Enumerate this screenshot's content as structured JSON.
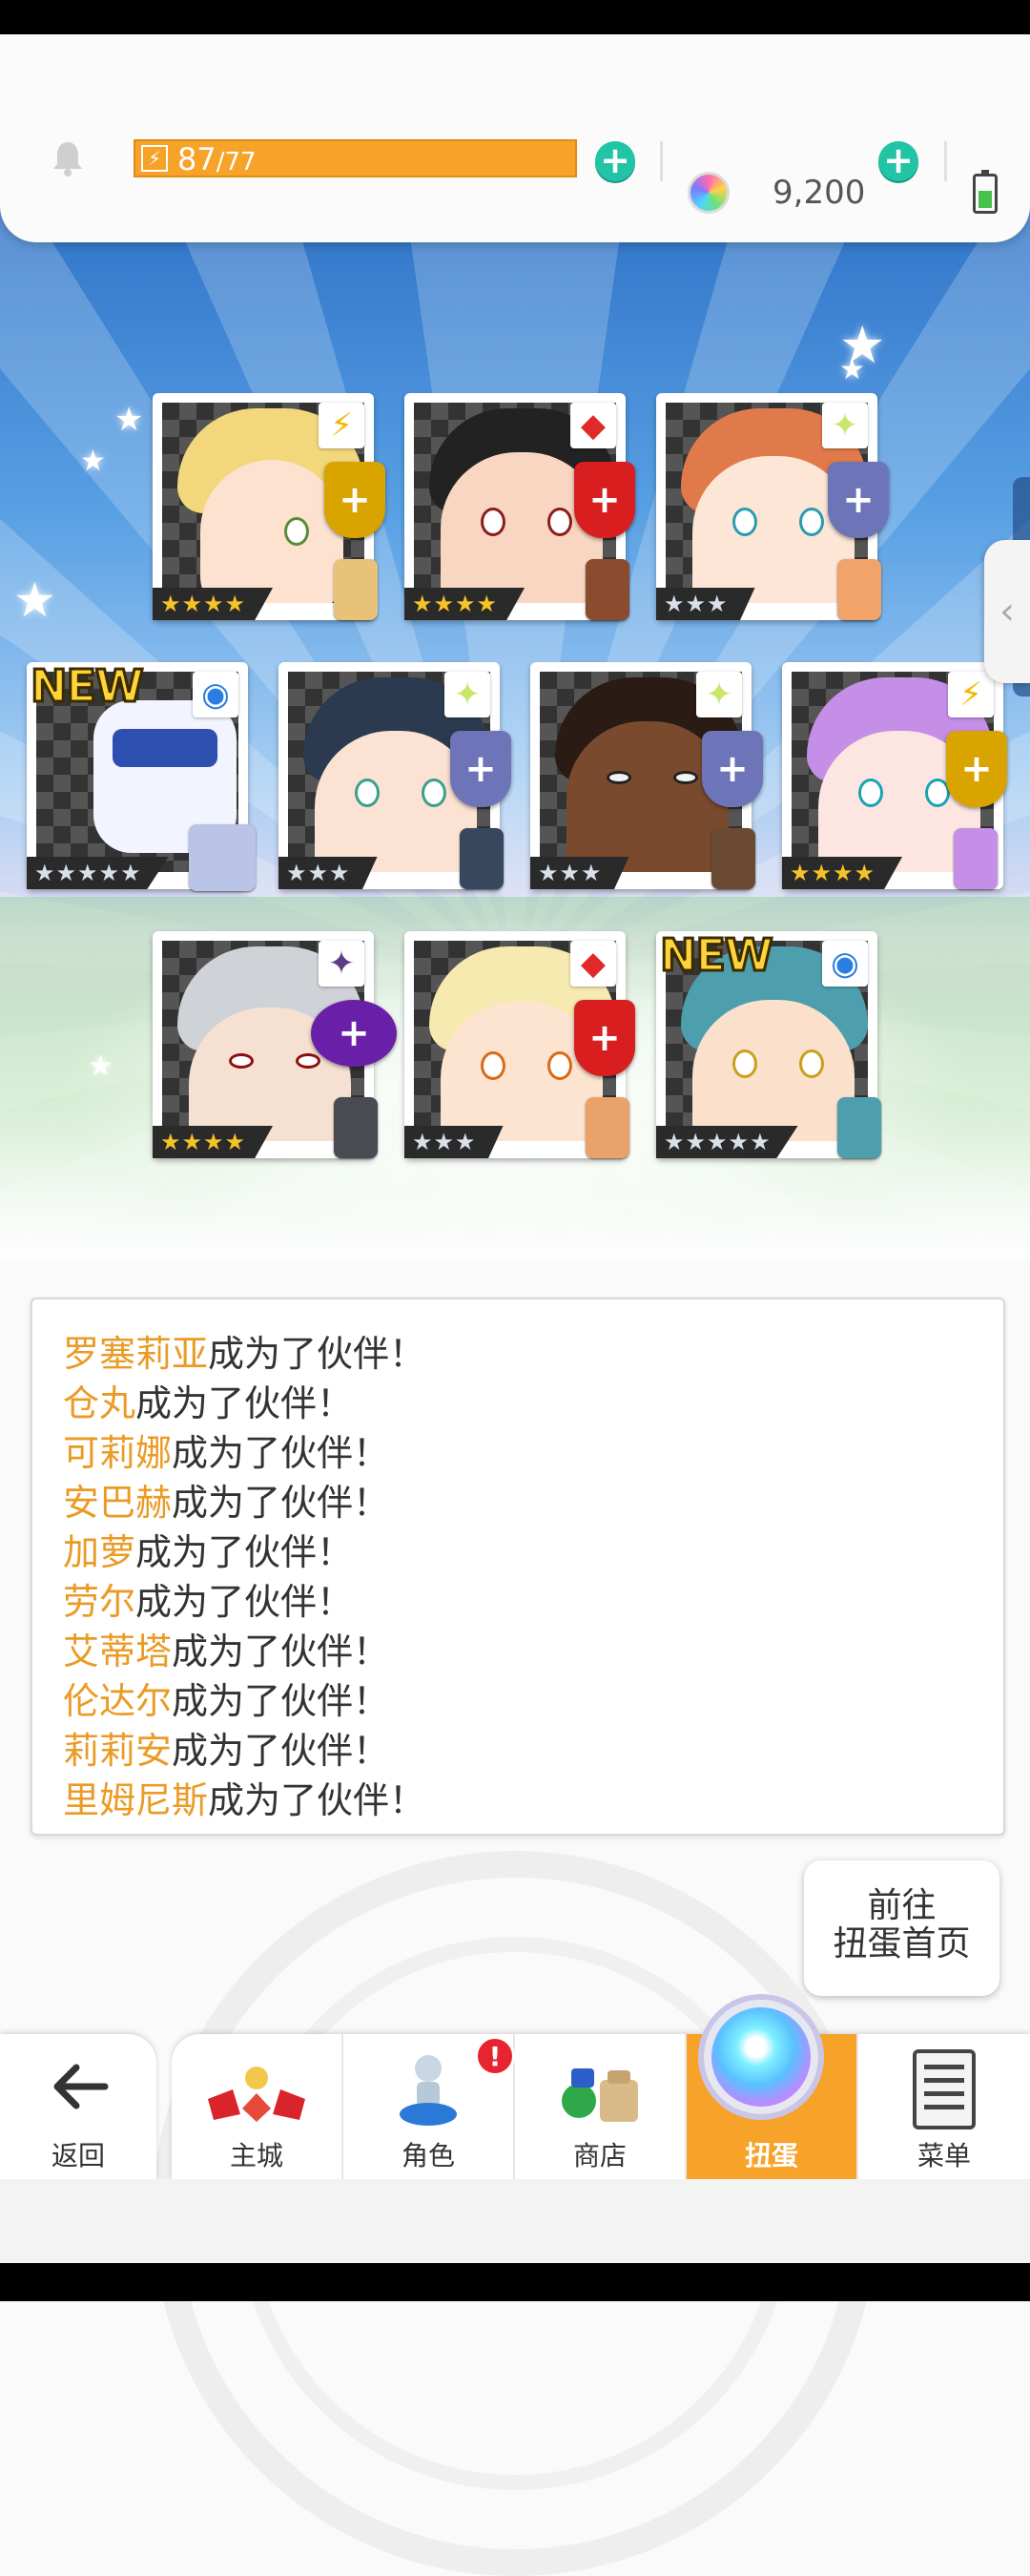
{
  "topbar": {
    "stamina_current": "87",
    "stamina_max": "/77",
    "gem_count": "9,200"
  },
  "cards": [
    {
      "stars": "★★★★",
      "element": "⚡",
      "is_new": false
    },
    {
      "stars": "★★★★",
      "element": "◆",
      "is_new": false
    },
    {
      "stars": "★★★",
      "element": "✦",
      "is_new": false
    },
    {
      "stars": "★★★★★",
      "element": "◉",
      "is_new": true
    },
    {
      "stars": "★★★",
      "element": "✦",
      "is_new": false
    },
    {
      "stars": "★★★",
      "element": "✦",
      "is_new": false
    },
    {
      "stars": "★★★★",
      "element": "⚡",
      "is_new": false
    },
    {
      "stars": "★★★★",
      "element": "✦",
      "is_new": false
    },
    {
      "stars": "★★★",
      "element": "◆",
      "is_new": false
    },
    {
      "stars": "★★★★★",
      "element": "◉",
      "is_new": true
    }
  ],
  "new_label": "NEW",
  "messages": {
    "suffix": "成为了伙伴！",
    "names": [
      "罗塞莉亚",
      "仓丸",
      "可莉娜",
      "安巴赫",
      "加萝",
      "劳尔",
      "艾蒂塔",
      "伦达尔",
      "莉莉安",
      "里姆尼斯"
    ]
  },
  "goto_button": {
    "line1": "前往",
    "line2": "扭蛋首页"
  },
  "nav": {
    "back": "返回",
    "tabs": [
      "主城",
      "角色",
      "商店",
      "扭蛋",
      "菜单"
    ],
    "alert": "!",
    "active_tab": "扭蛋"
  },
  "colors": {
    "accent_orange": "#f7a228",
    "teal_plus": "#22c4a6",
    "name_highlight": "#ea9b25"
  }
}
